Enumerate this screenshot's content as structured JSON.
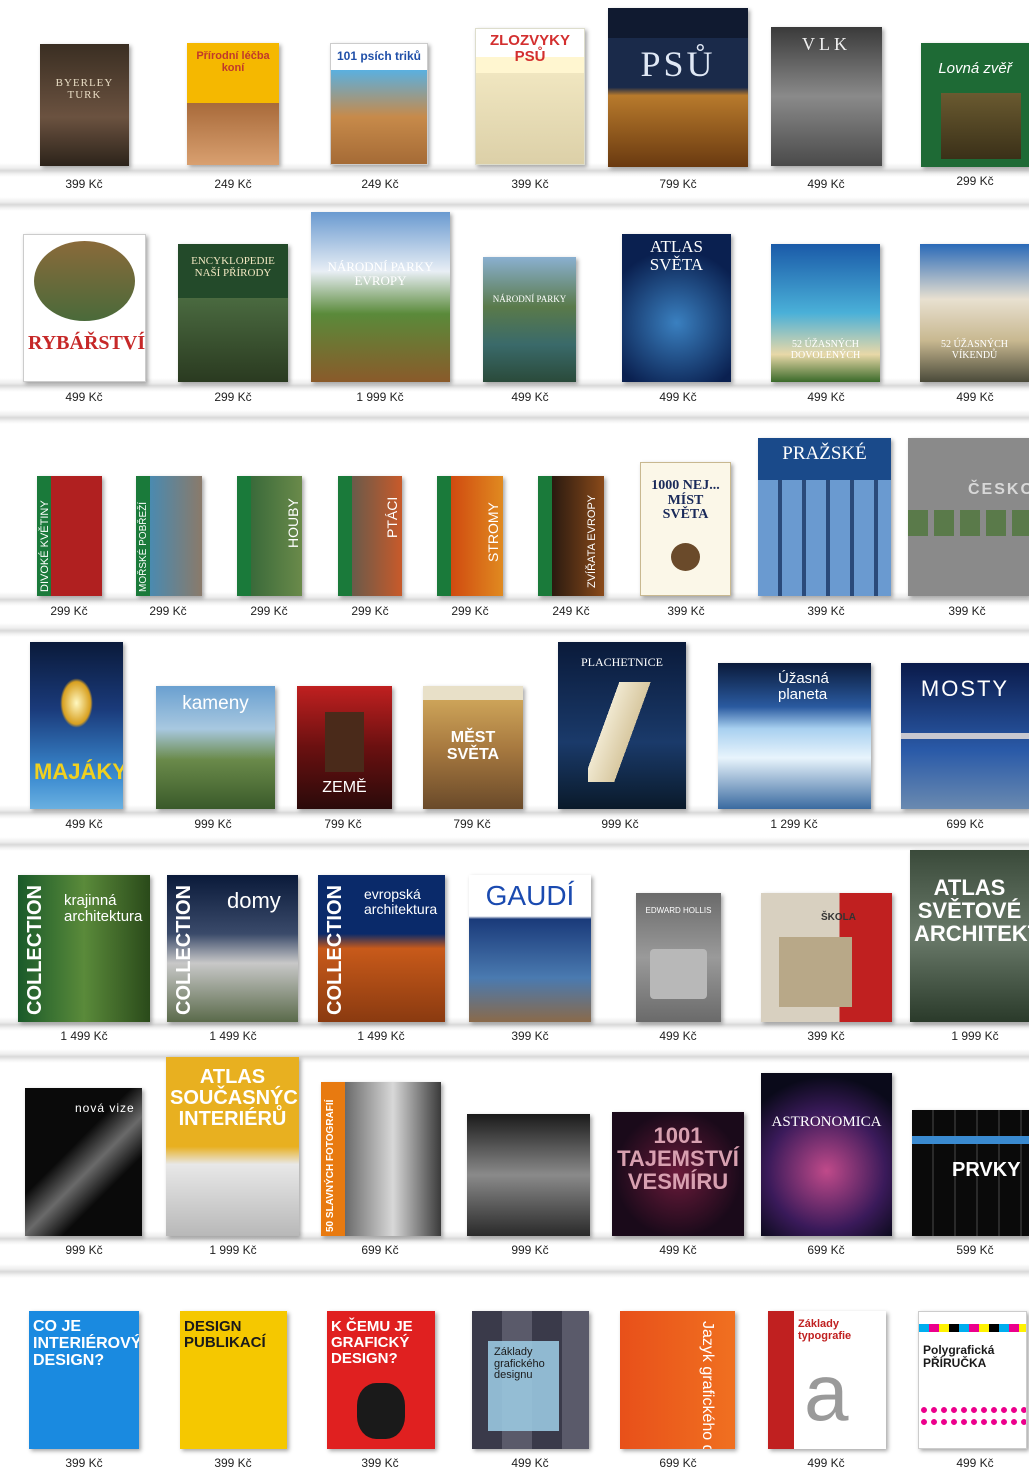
{
  "rows": [
    {
      "books": [
        {
          "title": "BYERLEY TURK",
          "price": "399 Kč"
        },
        {
          "title": "Přírodní léčba koní",
          "price": "249 Kč"
        },
        {
          "title": "101 psích triků",
          "price": "249 Kč"
        },
        {
          "title": "ZLOZVYKY PSŮ",
          "price": "399 Kč"
        },
        {
          "title": "PSŮ",
          "price": "799 Kč"
        },
        {
          "title": "VLK",
          "price": "499 Kč"
        },
        {
          "title": "Lovná zvěř",
          "price": "299 Kč"
        }
      ]
    },
    {
      "books": [
        {
          "title": "RYBÁŘSTVÍ",
          "price": "499 Kč"
        },
        {
          "title": "ENCYKLOPEDIE NAŠÍ PŘÍRODY",
          "price": "299 Kč"
        },
        {
          "title": "NÁRODNÍ PARKY EVROPY",
          "price": "1 999 Kč"
        },
        {
          "title": "NÁRODNÍ PARKY",
          "price": "499 Kč"
        },
        {
          "title": "ATLAS SVĚTA",
          "price": "499 Kč"
        },
        {
          "title": "52 ÚŽASNÝCH DOVOLENÝCH",
          "price": "499 Kč"
        },
        {
          "title": "52 ÚŽASNÝCH VÍKENDŮ",
          "price": "499 Kč"
        }
      ]
    },
    {
      "books": [
        {
          "title": "DIVOKÉ KVĚTINY",
          "price": "299 Kč"
        },
        {
          "title": "MOŘSKÉ POBŘEŽÍ",
          "price": "299 Kč"
        },
        {
          "title": "HOUBY",
          "price": "299 Kč"
        },
        {
          "title": "PTÁCI",
          "price": "299 Kč"
        },
        {
          "title": "STROMY",
          "price": "299 Kč"
        },
        {
          "title": "ZVÍŘATA EVROPY",
          "price": "249 Kč"
        },
        {
          "title": "1000 NEJ... MÍST SVĚTA",
          "price": "399 Kč"
        },
        {
          "title": "PRAŽSKÉ",
          "price": "399 Kč"
        },
        {
          "title": "ČESKO",
          "price": "399 Kč"
        }
      ]
    },
    {
      "books": [
        {
          "title": "MAJÁKY",
          "price": "499 Kč"
        },
        {
          "title": "kameny",
          "price": "999 Kč"
        },
        {
          "title": "ZEMĚ",
          "price": "799 Kč"
        },
        {
          "title": "MĚST SVĚTA",
          "price": "799 Kč"
        },
        {
          "title": "PLACHETNICE",
          "price": "999 Kč"
        },
        {
          "title": "Úžasná planeta",
          "price": "1 299 Kč"
        },
        {
          "title": "MOSTY",
          "price": "699 Kč"
        }
      ]
    },
    {
      "books": [
        {
          "title": "krajinná architektura",
          "price": "1 499 Kč"
        },
        {
          "title": "domy",
          "price": "1 499 Kč"
        },
        {
          "title": "evropská architektura",
          "price": "1 499 Kč"
        },
        {
          "title": "GAUDÍ",
          "price": "399 Kč"
        },
        {
          "title": "EDWARD HOLLIS",
          "price": "499 Kč"
        },
        {
          "title": "ŠKOLA",
          "price": "399 Kč"
        },
        {
          "title": "ATLAS SVĚTOVÉ ARCHITEKTURY",
          "price": "1 999 Kč"
        }
      ]
    },
    {
      "books": [
        {
          "title": "nová vize",
          "price": "999 Kč"
        },
        {
          "title": "ATLAS SOUČASNÝCH INTERIÉRŮ",
          "price": "1 999 Kč"
        },
        {
          "title": "50 SLAVNÝCH FOTOGRAFIÍ",
          "price": "699 Kč"
        },
        {
          "title": "",
          "price": "999 Kč"
        },
        {
          "title": "1001 TAJEMSTVÍ VESMÍRU",
          "price": "499 Kč"
        },
        {
          "title": "ASTRONOMICA",
          "price": "699 Kč"
        },
        {
          "title": "PRVKY",
          "price": "599 Kč"
        }
      ]
    },
    {
      "books": [
        {
          "title": "CO JE INTERIÉROVÝ DESIGN?",
          "price": "399 Kč"
        },
        {
          "title": "DESIGN PUBLIKACÍ",
          "price": "399 Kč"
        },
        {
          "title": "K ČEMU JE GRAFICKÝ DESIGN?",
          "price": "399 Kč"
        },
        {
          "title": "Základy grafického designu",
          "price": "499 Kč"
        },
        {
          "title": "Jazyk grafického designu",
          "price": "699 Kč"
        },
        {
          "title": "Základy typografie",
          "price": "499 Kč"
        },
        {
          "title": "Polygrafická PŘÍRUČKA",
          "price": "499 Kč"
        }
      ]
    }
  ]
}
